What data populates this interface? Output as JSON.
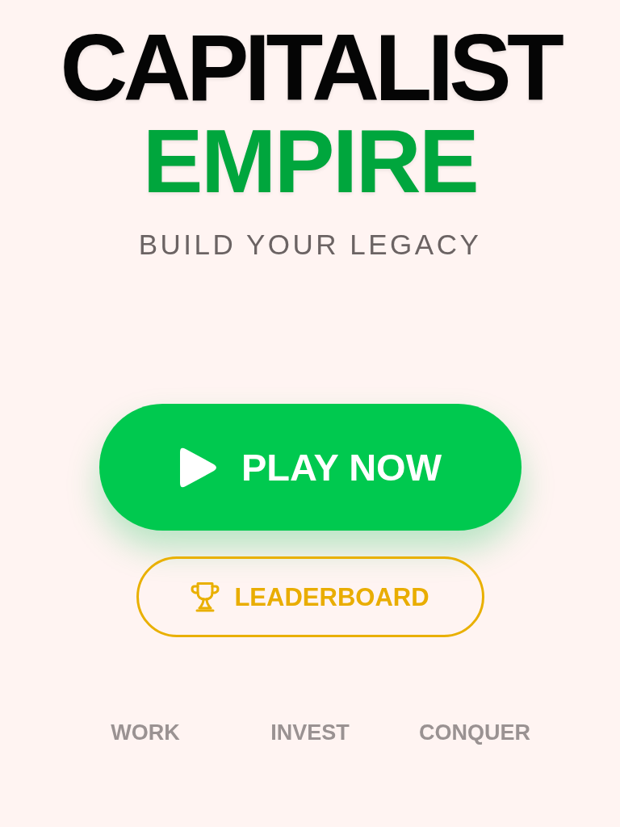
{
  "title": {
    "line_1": "CAPITALIST",
    "line_2": "EMPIRE"
  },
  "tagline": "BUILD YOUR LEGACY",
  "buttons": [
    {
      "kind": "primary",
      "label": "PLAY NOW"
    },
    {
      "kind": "outline",
      "label": "LEADERBOARD"
    }
  ],
  "features": [
    "WORK",
    "INVEST",
    "CONQUER"
  ]
}
